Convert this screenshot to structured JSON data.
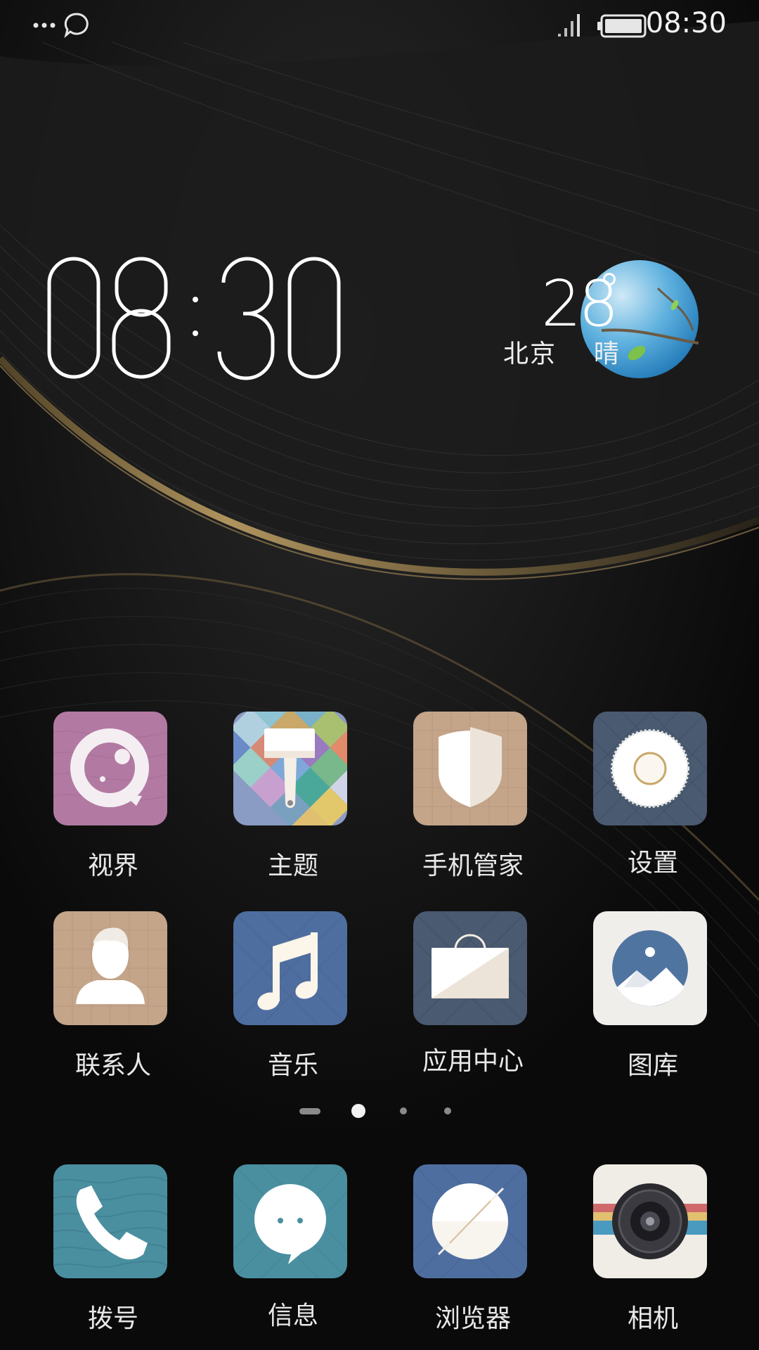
{
  "status_bar": {
    "time": "08:30",
    "left_icons": [
      "more-dots-icon",
      "message-bubble-icon"
    ],
    "right_icons": [
      "signal-icon",
      "battery-icon"
    ]
  },
  "clock_widget": {
    "hours": "08",
    "minutes": "30"
  },
  "weather_widget": {
    "temperature": "28",
    "city": "北京",
    "condition": "晴"
  },
  "apps": [
    {
      "label": "视界",
      "icon": "vision-icon"
    },
    {
      "label": "主题",
      "icon": "theme-brush-icon"
    },
    {
      "label": "手机管家",
      "icon": "shield-icon"
    },
    {
      "label": "设置",
      "icon": "gear-icon"
    },
    {
      "label": "联系人",
      "icon": "contact-person-icon"
    },
    {
      "label": "音乐",
      "icon": "music-note-icon"
    },
    {
      "label": "应用中心",
      "icon": "shopping-bag-icon"
    },
    {
      "label": "图库",
      "icon": "gallery-icon"
    }
  ],
  "page_indicator": {
    "pages": 4,
    "current_page": 2
  },
  "dock": [
    {
      "label": "拨号",
      "icon": "phone-icon"
    },
    {
      "label": "信息",
      "icon": "message-icon"
    },
    {
      "label": "浏览器",
      "icon": "compass-icon"
    },
    {
      "label": "相机",
      "icon": "camera-icon"
    }
  ],
  "colors": {
    "background": "#0b0b0b",
    "accent_gold": "#b89a5e",
    "text": "#ffffff"
  }
}
